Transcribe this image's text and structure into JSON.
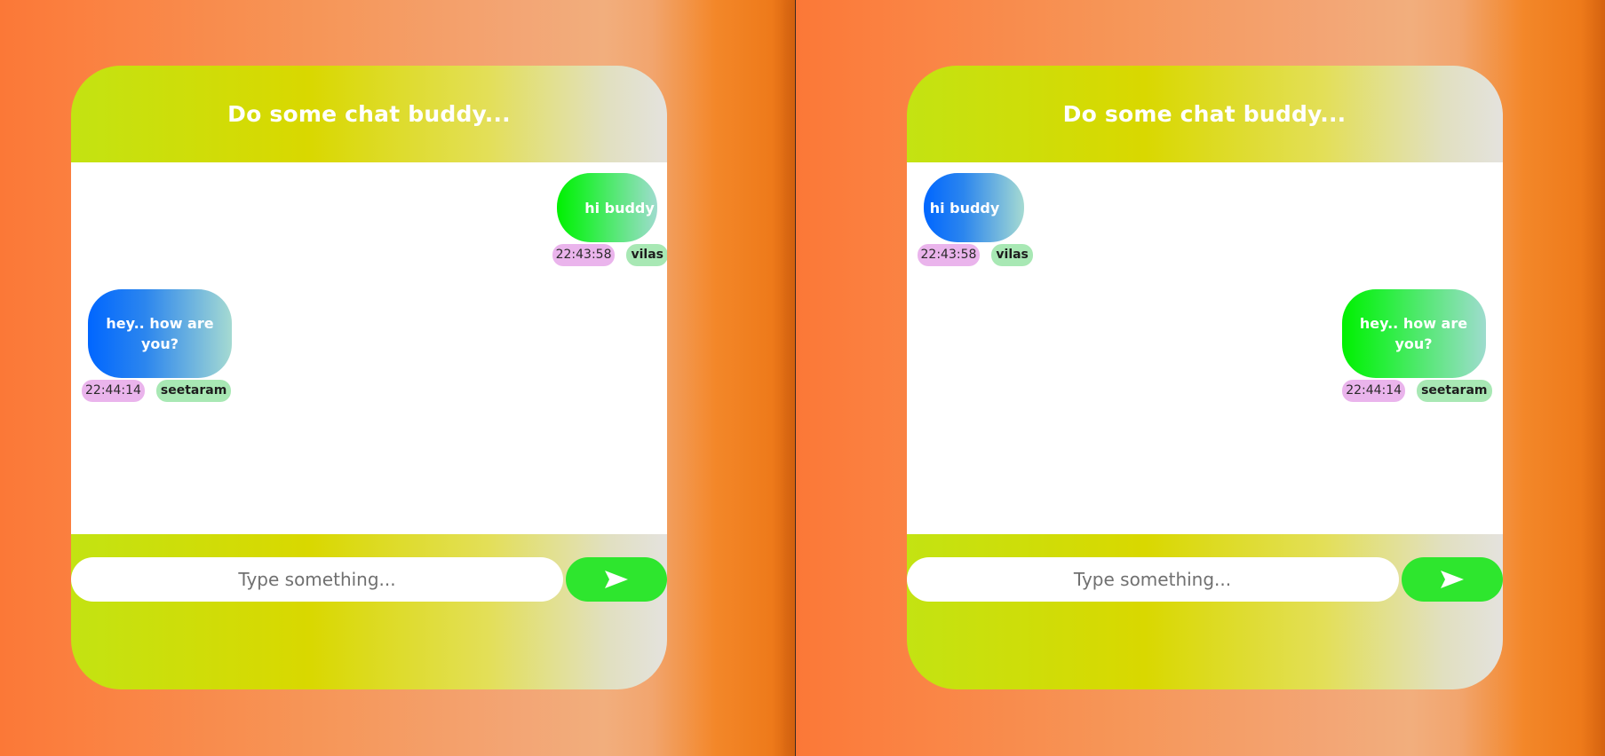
{
  "panes": [
    {
      "id": "left",
      "header_title": "Do some chat buddy...",
      "messages": [
        {
          "text": "hi buddy",
          "time": "22:43:58",
          "user": "vilas",
          "align": "right",
          "style": "sent"
        },
        {
          "text": "hey.. how are you?",
          "time": "22:44:14",
          "user": "seetaram",
          "align": "left",
          "style": "received"
        }
      ],
      "composer": {
        "placeholder": "Type something...",
        "send_icon": "send-arrow-icon"
      }
    },
    {
      "id": "right",
      "header_title": "Do some chat buddy...",
      "messages": [
        {
          "text": "hi buddy",
          "time": "22:43:58",
          "user": "vilas",
          "align": "left",
          "style": "received"
        },
        {
          "text": "hey.. how are you?",
          "time": "22:44:14",
          "user": "seetaram",
          "align": "right",
          "style": "sent"
        }
      ],
      "composer": {
        "placeholder": "Type something...",
        "send_icon": "send-arrow-icon"
      }
    }
  ],
  "colors": {
    "send_button": "#2ee62e",
    "time_badge": "#eab4ec",
    "user_badge": "#a8e8b4",
    "sent_bubble_start": "#00f000",
    "received_bubble_start": "#0066ff"
  }
}
